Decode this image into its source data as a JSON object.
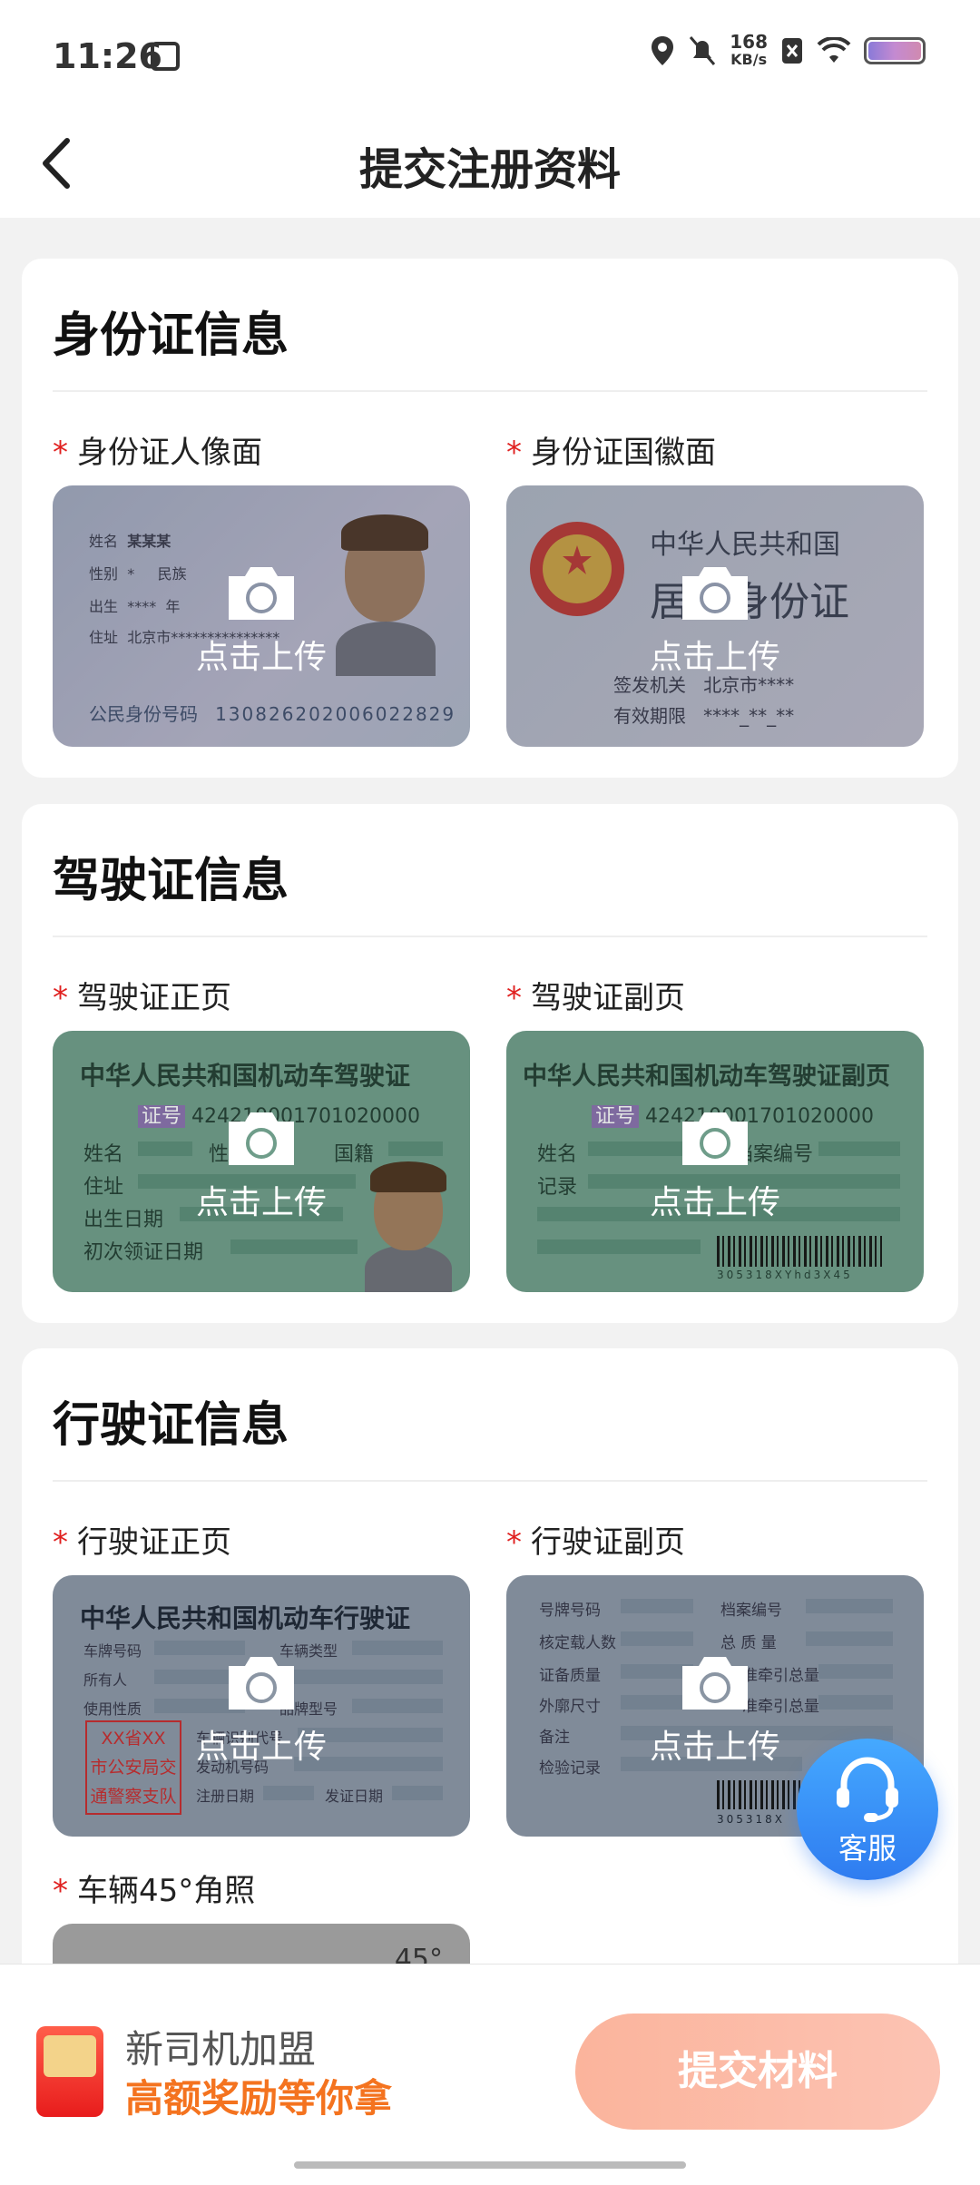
{
  "status_bar": {
    "time": "11:26",
    "net_speed_value": "168",
    "net_speed_unit": "KB/s"
  },
  "header": {
    "title": "提交注册资料"
  },
  "sections": {
    "id_card": {
      "title": "身份证信息",
      "items": [
        {
          "label": "身份证人像面",
          "upload_text": "点击上传"
        },
        {
          "label": "身份证国徽面",
          "upload_text": "点击上传"
        }
      ],
      "front_sample": {
        "name_label": "姓名",
        "name_value": "某某某",
        "gender_label": "性别",
        "ethnic_label": "民族",
        "birth_label": "出生",
        "year_label": "年",
        "address_label": "住址",
        "address_value": "北京市***************",
        "id_label": "公民身份号码",
        "id_value": "130826202006022829"
      },
      "back_sample": {
        "country": "中华人民共和国",
        "doc": "居民身份证",
        "issuer_label": "签发机关",
        "issuer_value": "北京市****",
        "valid_label": "有效期限",
        "valid_value": "****_**_**"
      }
    },
    "driver_license": {
      "title": "驾驶证信息",
      "items": [
        {
          "label": "驾驶证正页",
          "upload_text": "点击上传"
        },
        {
          "label": "驾驶证副页",
          "upload_text": "点击上传"
        }
      ],
      "front_sample": {
        "heading": "中华人民共和国机动车驾驶证",
        "cert_label": "证号",
        "cert_value": "424210001701020000",
        "name_label": "姓名",
        "gender_label": "性",
        "nationality_label": "国籍",
        "address_label": "住址",
        "birth_label": "出生日期",
        "first_issue_label": "初次领证日期"
      },
      "back_sample": {
        "heading": "中华人民共和国机动车驾驶证副页",
        "cert_label": "证号",
        "cert_value": "424210001701020000",
        "name_label": "姓名",
        "file_no_label": "档案编号",
        "record_label": "记录",
        "barcode_text": "305318XYhd3X45"
      }
    },
    "vehicle_license": {
      "title": "行驶证信息",
      "items": [
        {
          "label": "行驶证正页",
          "upload_text": "点击上传"
        },
        {
          "label": "行驶证副页",
          "upload_text": "点击上传"
        },
        {
          "label": "车辆45°角照",
          "badge": "45°"
        }
      ],
      "front_sample": {
        "heading": "中华人民共和国机动车行驶证",
        "plate_label": "车牌号码",
        "vehicle_type_label": "车辆类型",
        "owner_label": "所有人",
        "use_label": "使用性质",
        "model_label": "品牌型号",
        "vin_label": "车辆识别代号",
        "engine_label": "发动机号码",
        "reg_date_label": "注册日期",
        "issue_date_label": "发证日期",
        "stamp_line1": "XX省XX",
        "stamp_line2": "市公安局交",
        "stamp_line3": "通警察支队"
      },
      "back_sample": {
        "plate_label": "号牌号码",
        "file_no_label": "档案编号",
        "seats_label": "核定载人数",
        "total_mass_label": "总 质 量",
        "curb_mass_label": "证备质量",
        "tow_label": "准牵引总量",
        "dims_label": "外廓尺寸",
        "tow2_label": "准牵引总量",
        "remarks_label": "备注",
        "inspection_label": "检验记录",
        "barcode_text": "305318X"
      }
    }
  },
  "customer_service": {
    "label": "客服"
  },
  "promo": {
    "line1": "新司机加盟",
    "line2": "高额奖励等你拿"
  },
  "submit_button": {
    "label": "提交材料"
  },
  "colors": {
    "accent": "#f4731f",
    "required_star": "#e0201f",
    "submit_bg": "#fbb49c",
    "service_bg": "#2f7cf0"
  }
}
